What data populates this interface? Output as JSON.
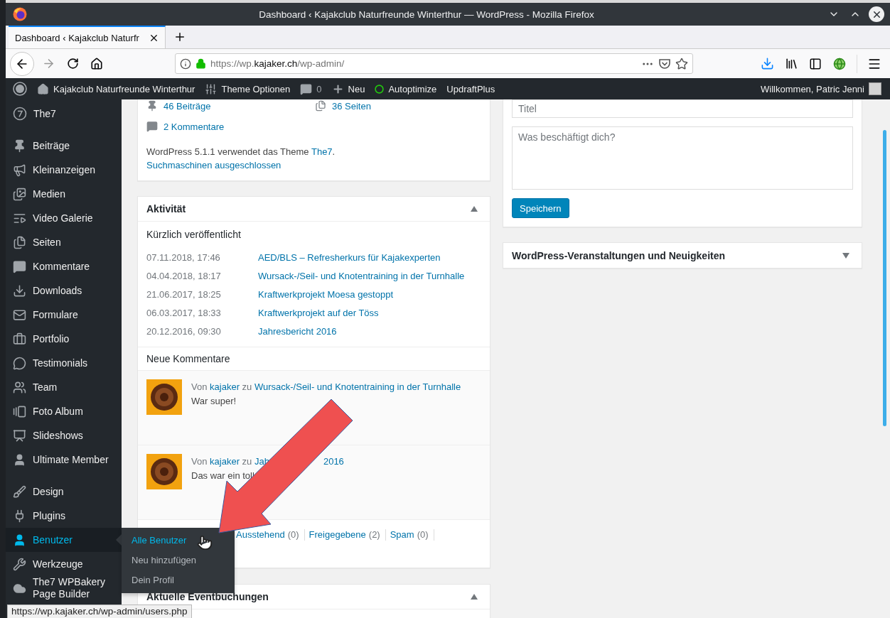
{
  "window": {
    "title": "Dashboard ‹ Kajakclub Naturfreunde Winterthur — WordPress - Mozilla Firefox"
  },
  "browser": {
    "tabs": [
      {
        "label": "Dashboard ‹ Kajakclub Naturfr",
        "selected": true
      }
    ],
    "url": "https://wp.**kajaker.ch**/wp-admin/"
  },
  "admin_bar": {
    "site": "Kajakclub Naturfreunde Winterthur",
    "items": [
      {
        "kind": "theme",
        "label": "Theme Optionen"
      },
      {
        "kind": "comments",
        "label": "0"
      },
      {
        "kind": "new",
        "label": "Neu"
      },
      {
        "kind": "status",
        "label": "Autoptimize"
      },
      {
        "kind": "plain",
        "label": "UpdraftPlus"
      }
    ],
    "greeting": "Willkommen, Patric Jenni"
  },
  "sidebar": {
    "groups": [
      [
        {
          "kind": "the7",
          "label": "The7",
          "selected": false
        }
      ],
      [
        {
          "kind": "pin",
          "label": "Beiträge",
          "selected": false
        },
        {
          "kind": "megaphone",
          "label": "Kleinanzeigen",
          "selected": false
        },
        {
          "kind": "media",
          "label": "Medien",
          "selected": false
        },
        {
          "kind": "video",
          "label": "Video Galerie",
          "selected": false
        },
        {
          "kind": "pages",
          "label": "Seiten",
          "selected": false
        },
        {
          "kind": "comment",
          "label": "Kommentare",
          "selected": false
        },
        {
          "kind": "download",
          "label": "Downloads",
          "selected": false
        },
        {
          "kind": "mail",
          "label": "Formulare",
          "selected": false
        },
        {
          "kind": "briefcase",
          "label": "Portfolio",
          "selected": false
        },
        {
          "kind": "quote",
          "label": "Testimonials",
          "selected": false
        },
        {
          "kind": "team",
          "label": "Team",
          "selected": false
        },
        {
          "kind": "album",
          "label": "Foto Album",
          "selected": false
        },
        {
          "kind": "slides",
          "label": "Slideshows",
          "selected": false
        },
        {
          "kind": "user",
          "label": "Ultimate Member",
          "selected": false
        }
      ],
      [
        {
          "kind": "brush",
          "label": "Design",
          "selected": false
        },
        {
          "kind": "plug",
          "label": "Plugins",
          "selected": false
        },
        {
          "kind": "user",
          "label": "Benutzer",
          "selected": true,
          "submenu": [
            {
              "label": "Alle Benutzer",
              "selected": true
            },
            {
              "label": "Neu hinzufügen",
              "selected": false
            },
            {
              "label": "Dein Profil",
              "selected": false
            }
          ]
        },
        {
          "kind": "wrench",
          "label": "Werkzeuge",
          "selected": false
        },
        {
          "kind": "cloud",
          "label": "The7 WPBakery Page Builder",
          "selected": false
        }
      ]
    ]
  },
  "glance": {
    "items": [
      {
        "kind": "posts",
        "label": "46 Beiträge"
      },
      {
        "kind": "pages",
        "label": "36 Seiten"
      },
      {
        "kind": "comments",
        "label": "2 Kommentare"
      }
    ],
    "version_text": "WordPress 5.1.1 verwendet das Theme ",
    "theme_link": "The7",
    "version_end": ".",
    "search_engines": "Suchmaschinen ausgeschlossen"
  },
  "activity": {
    "title": "Aktivität",
    "expanded": true,
    "recent_title": "Kürzlich veröffentlicht",
    "recent": [
      {
        "date": "07.11.2018, 17:46",
        "title": "AED/BLS – Refresherkurs für Kajakexperten"
      },
      {
        "date": "04.04.2018, 18:17",
        "title": "Wursack-/Seil- und Knotentraining in der Turnhalle"
      },
      {
        "date": "21.06.2017, 18:25",
        "title": "Kraftwerkprojekt Moesa gestoppt"
      },
      {
        "date": "06.03.2017, 18:33",
        "title": "Kraftwerkprojekt auf der Töss"
      },
      {
        "date": "20.12.2016, 09:30",
        "title": "Jahresbericht 2016"
      }
    ],
    "comments_title": "Neue Kommentare",
    "comments": [
      {
        "prefix": "Von",
        "author": "kajaker",
        "mid": "zu",
        "post": "Wursack-/Seil- und Knotentraining in der Turnhalle",
        "text": "War super!"
      },
      {
        "prefix": "Von",
        "author": "kajaker",
        "mid": "zu",
        "post": "Jah",
        "post_end": "2016",
        "text": "Das war ein toll"
      }
    ],
    "filters": [
      {
        "label": "Ausstehend",
        "count": "(0)"
      },
      {
        "label": "Freigegebene",
        "count": "(2)"
      },
      {
        "label": "Spam",
        "count": "(0)"
      }
    ]
  },
  "events": {
    "title": "Aktuelle Eventbuchungen",
    "expanded": true
  },
  "quick_draft": {
    "title_placeholder": "Titel",
    "content_placeholder": "Was beschäftigt dich?",
    "button": "Speichern"
  },
  "news": {
    "title": "WordPress-Veranstaltungen und Neuigkeiten",
    "expanded": false
  },
  "status_bar": {
    "url": "https://wp.kajaker.ch/wp-admin/users.php"
  }
}
